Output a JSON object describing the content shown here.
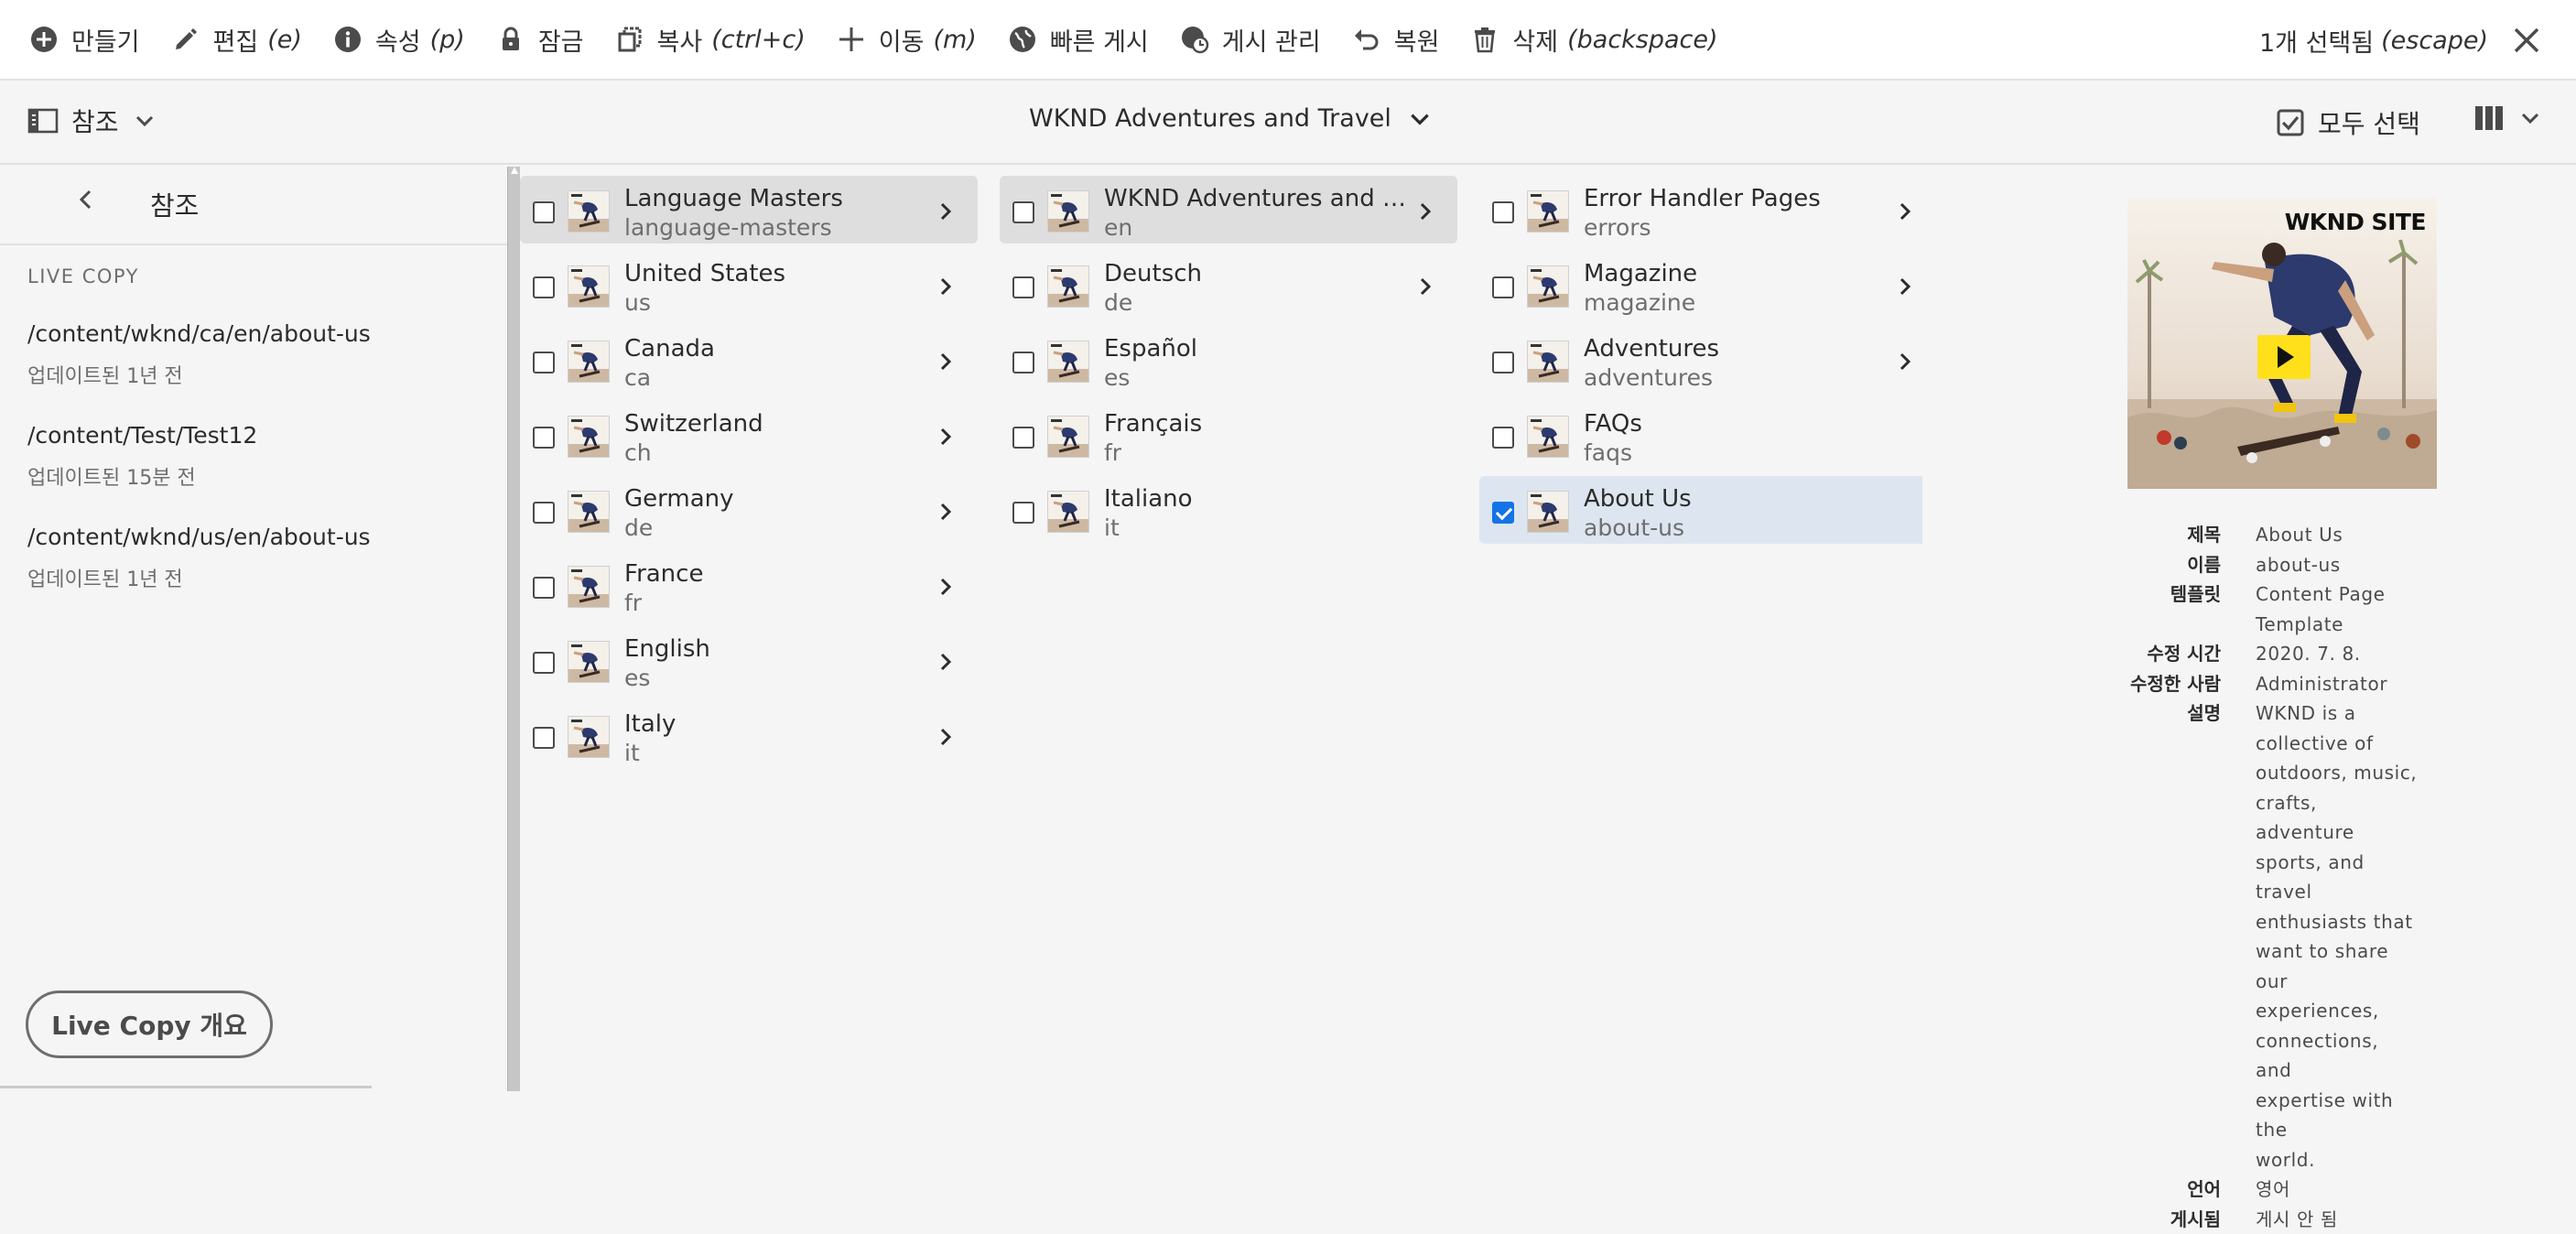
{
  "actionbar": {
    "items": [
      {
        "label": "만들기",
        "kbd": ""
      },
      {
        "label": "편집",
        "kbd": "(e)"
      },
      {
        "label": "속성",
        "kbd": "(p)"
      },
      {
        "label": "잠금",
        "kbd": ""
      },
      {
        "label": "복사",
        "kbd": "(ctrl+c)"
      },
      {
        "label": "이동",
        "kbd": "(m)"
      },
      {
        "label": "빠른 게시",
        "kbd": ""
      },
      {
        "label": "게시 관리",
        "kbd": ""
      },
      {
        "label": "복원",
        "kbd": ""
      },
      {
        "label": "삭제",
        "kbd": "(backspace)"
      }
    ],
    "selection": {
      "label": "1개 선택됨",
      "kbd": "(escape)"
    }
  },
  "toolbar": {
    "rail_toggle_label": "참조",
    "collection_title": "WKND Adventures and Travel",
    "select_all_label": "모두 선택"
  },
  "rail": {
    "title": "참조",
    "section": "LIVE COPY",
    "references": [
      {
        "path": "/content/wknd/ca/en/about-us",
        "time": "업데이트된 1년 전"
      },
      {
        "path": "/content/Test/Test12",
        "time": "업데이트된 15분 전"
      },
      {
        "path": "/content/wknd/us/en/about-us",
        "time": "업데이트된 1년 전"
      }
    ],
    "button_label": "Live Copy 개요"
  },
  "columns": [
    [
      {
        "title": "Language Masters",
        "name": "language-masters"
      },
      {
        "title": "United States",
        "name": "us"
      },
      {
        "title": "Canada",
        "name": "ca"
      },
      {
        "title": "Switzerland",
        "name": "ch"
      },
      {
        "title": "Germany",
        "name": "de"
      },
      {
        "title": "France",
        "name": "fr"
      },
      {
        "title": "English",
        "name": "es"
      },
      {
        "title": "Italy",
        "name": "it"
      }
    ],
    [
      {
        "title": "WKND Adventures and Tr...",
        "name": "en"
      },
      {
        "title": "Deutsch",
        "name": "de"
      },
      {
        "title": "Español",
        "name": "es"
      },
      {
        "title": "Français",
        "name": "fr"
      },
      {
        "title": "Italiano",
        "name": "it"
      }
    ],
    [
      {
        "title": "Error Handler Pages",
        "name": "errors"
      },
      {
        "title": "Magazine",
        "name": "magazine"
      },
      {
        "title": "Adventures",
        "name": "adventures"
      },
      {
        "title": "FAQs",
        "name": "faqs"
      },
      {
        "title": "About Us",
        "name": "about-us"
      }
    ]
  ],
  "preview": {
    "brand": "WKND SITE",
    "meta": [
      {
        "label": "제목",
        "lines": [
          "About Us"
        ]
      },
      {
        "label": "이름",
        "lines": [
          "about-us"
        ]
      },
      {
        "label": "템플릿",
        "lines": [
          "Content Page",
          "Template"
        ]
      },
      {
        "label": "수정 시간",
        "lines": [
          "2020. 7. 8."
        ]
      },
      {
        "label": "수정한 사람",
        "lines": [
          "Administrator"
        ]
      },
      {
        "label": "설명",
        "lines": [
          "WKND is a",
          "collective of",
          "outdoors, music,",
          "crafts, adventure",
          "sports, and travel",
          "enthusiasts that",
          "want to share our",
          "experiences,",
          "connections, and",
          "expertise with the",
          "world."
        ]
      },
      {
        "label": "언어",
        "lines": [
          "영어"
        ]
      },
      {
        "label": "게시됨",
        "lines": [
          "게시 안 됨"
        ]
      }
    ]
  },
  "colors": {
    "selected_row": "#dde6f0",
    "active_row": "#dedede",
    "checkbox_accent": "#1473e6",
    "background": "#f5f5f5"
  }
}
